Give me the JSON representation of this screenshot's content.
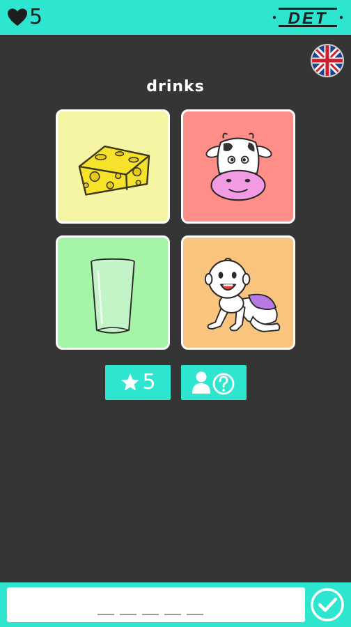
{
  "header": {
    "lives": "5",
    "logo_text": "DET"
  },
  "language": {
    "flag": "uk-flag-icon"
  },
  "puzzle": {
    "category": "drinks",
    "cards": [
      {
        "icon": "cheese-icon",
        "color": "#f6f5a3"
      },
      {
        "icon": "cow-icon",
        "color": "#ff8e89"
      },
      {
        "icon": "glass-icon",
        "color": "#a6f4a8"
      },
      {
        "icon": "baby-icon",
        "color": "#f9c47d"
      }
    ],
    "answer_slots": 5
  },
  "actions": {
    "hints": "5",
    "hint_icon": "star-icon",
    "help_icon": "ask-friend-icon",
    "submit_icon": "check-icon"
  },
  "colors": {
    "accent": "#2ee6cf",
    "background": "#353535"
  }
}
